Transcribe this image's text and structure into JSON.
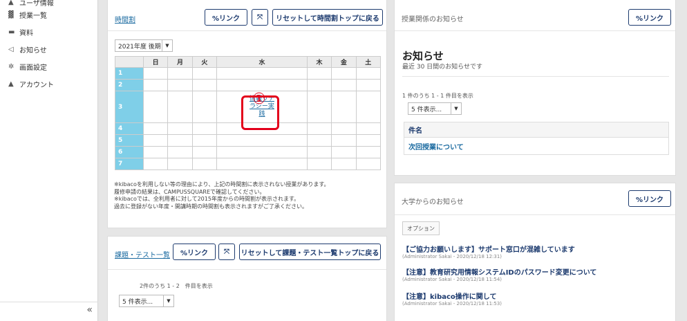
{
  "sidebar": {
    "items": [
      {
        "icon": "user-icon",
        "glyph": "▲",
        "label": "ユーザ情報"
      },
      {
        "icon": "graduation-icon",
        "glyph": "▓",
        "label": "授業一覧"
      },
      {
        "icon": "folder-icon",
        "glyph": "▬",
        "label": "資料"
      },
      {
        "icon": "megaphone-icon",
        "glyph": "◁",
        "label": "お知らせ"
      },
      {
        "icon": "gear-icon",
        "glyph": "✲",
        "label": "画面設定"
      },
      {
        "icon": "account-icon",
        "glyph": "▲",
        "label": "アカウント"
      }
    ],
    "collapse_label": "«"
  },
  "timetable": {
    "title": "時間割",
    "link_button": "%リンク",
    "expand_button": "⤧",
    "reset_button": "リセットして時間割トップに戻る",
    "term_select": "2021年度 後期",
    "days": [
      "日",
      "月",
      "火",
      "水",
      "木",
      "金",
      "土"
    ],
    "periods": [
      "1",
      "2",
      "3",
      "4",
      "5",
      "6",
      "7"
    ],
    "course": "情報リテラシー実践",
    "course_lines": [
      "情報リテ",
      "ラシー実",
      "践"
    ],
    "annotation_marker": "①",
    "notes": [
      "※kibacoを利用しない等の理由により、上記の時間割に表示されない授業があります。",
      "履修申請の結果は、CAMPUSSQUAREで確認してください。",
      "※kibacoでは、全利用者に対して2015年度からの時間割が表示されます。",
      "過去に登録がない年度・開講時期の時間割も表示されますがご了承ください。"
    ]
  },
  "assignments": {
    "title": "課題・テスト一覧",
    "link_button": "%リンク",
    "expand_button": "⤧",
    "reset_button": "リセットして課題・テスト一覧トップに戻る",
    "count_text": "2件のうち 1 - 2　件目を表示",
    "page_size_select": "5 件表示..."
  },
  "class_announcements": {
    "section_title": "授業関係のお知らせ",
    "link_button": "%リンク",
    "heading": "お知らせ",
    "subheading": "最近 30 日間のお知らせです",
    "count_text": "1 件のうち 1 - 1 件目を表示",
    "page_size_select": "5 件表示...",
    "column_header": "件名",
    "rows": [
      "次回授業について"
    ]
  },
  "university_news": {
    "section_title": "大学からのお知らせ",
    "link_button": "%リンク",
    "options_label": "オプション",
    "items": [
      {
        "title": "【ご協力お願いします】サポート窓口が混雑しています",
        "meta": "(Administrator Sakai - 2020/12/18 12:31)"
      },
      {
        "title": "【注意】教育研究用情報システムIDのパスワード変更について",
        "meta": "(Administrator Sakai - 2020/12/18 11:54)"
      },
      {
        "title": "【注意】kibaco操作に関して",
        "meta": "(Administrator Sakai - 2020/12/18 11:53)"
      }
    ]
  },
  "colors": {
    "period_cell": "#7fcfe8",
    "highlight": "#e3001b",
    "button_border": "#1c3a6e",
    "link": "#1a6aa0"
  }
}
